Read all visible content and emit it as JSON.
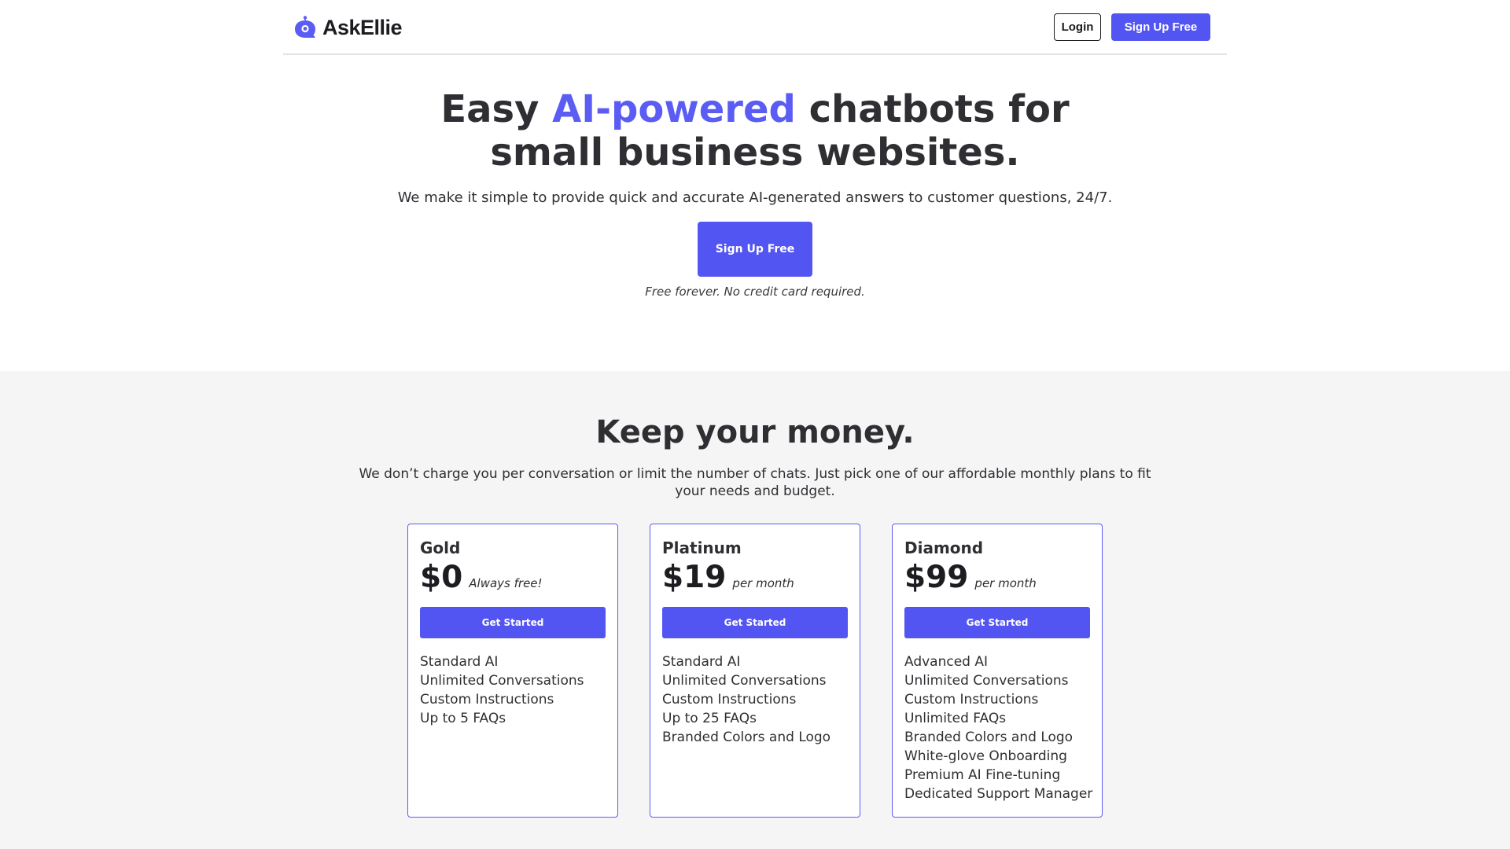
{
  "nav": {
    "logo_icon": "chat-bubble-robot-icon",
    "brand": "AskEllie",
    "login_label": "Login",
    "signup_label": "Sign Up Free"
  },
  "hero": {
    "title_part1": "Easy ",
    "title_accent": "AI-powered",
    "title_part2": " chatbots for",
    "title_line2": "small business websites.",
    "subtitle": "We make it simple to provide quick and accurate AI-generated answers to customer questions, 24/7.",
    "cta_label": "Sign Up Free",
    "note": "Free forever. No credit card required."
  },
  "pricing": {
    "title": "Keep your money.",
    "subtitle": "We don’t charge you per conversation or limit the number of chats. Just pick one of our affordable monthly plans to fit your needs and budget.",
    "plans": [
      {
        "name": "Gold",
        "price": "$0",
        "price_note": "Always free!",
        "button_label": "Get Started",
        "features": [
          "Standard AI",
          "Unlimited Conversations",
          "Custom Instructions",
          "Up to 5 FAQs"
        ]
      },
      {
        "name": "Platinum",
        "price": "$19",
        "price_note": "per month",
        "button_label": "Get Started",
        "features": [
          "Standard AI",
          "Unlimited Conversations",
          "Custom Instructions",
          "Up to 25 FAQs",
          "Branded Colors and Logo"
        ]
      },
      {
        "name": "Diamond",
        "price": "$99",
        "price_note": "per month",
        "button_label": "Get Started",
        "features": [
          "Advanced AI",
          "Unlimited Conversations",
          "Custom Instructions",
          "Unlimited FAQs",
          "Branded Colors and Logo",
          "White-glove Onboarding",
          "Premium AI Fine-tuning",
          "Dedicated Support Manager"
        ]
      }
    ]
  },
  "colors": {
    "accent": "#5a5cf3",
    "button": "#5355f2",
    "text": "#2f2f33",
    "section_bg": "#f5f5f6"
  }
}
